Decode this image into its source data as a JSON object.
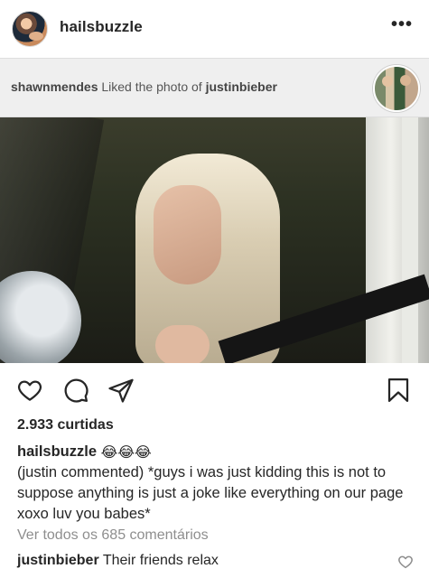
{
  "post": {
    "username": "hailsbuzzle",
    "more_label": "•••"
  },
  "activity": {
    "actor": "shawnmendes",
    "text": " Liked the photo of ",
    "target": "justinbieber"
  },
  "actions": {
    "like_icon": "heart-icon",
    "comment_icon": "comment-icon",
    "share_icon": "share-icon",
    "save_icon": "bookmark-icon"
  },
  "likes": "2.933 curtidas",
  "caption": {
    "username": "hailsbuzzle",
    "emojis": [
      "😂",
      "😂",
      "😂"
    ],
    "text": "(justin commented) *guys i was just kidding this is not  to suppose anything is just a joke like everything on our page xoxo luv you babes*"
  },
  "view_all_comments": "Ver todos os 685 comentários",
  "comment": {
    "username": "justinbieber",
    "text": "Their friends relax"
  },
  "colors": {
    "text": "#262626",
    "muted": "#8e8e8e",
    "banner_bg": "#efefef"
  }
}
